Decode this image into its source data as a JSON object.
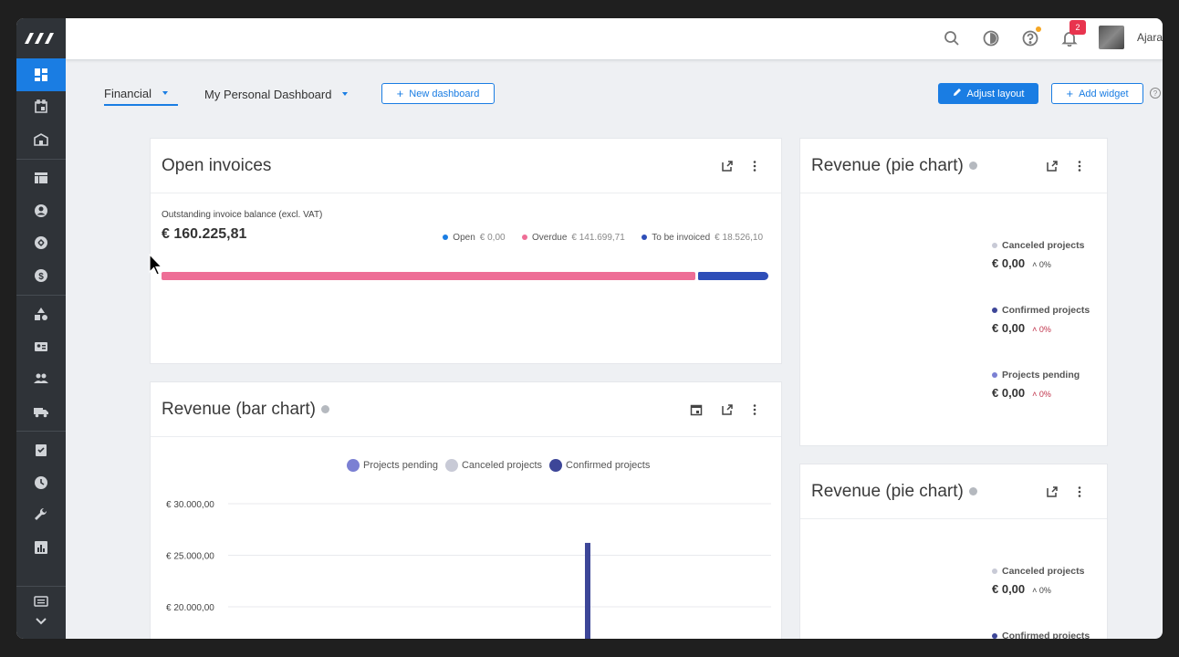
{
  "topbar": {
    "username": "Ajara",
    "notifications_count": "2"
  },
  "sidebar": {
    "items": [
      "dashboard",
      "calendar",
      "organization",
      "table",
      "contact",
      "sync",
      "dollar",
      "shapes",
      "id-card",
      "people",
      "truck",
      "task",
      "clock",
      "wrench",
      "report",
      "feedback"
    ]
  },
  "tabs": [
    {
      "label": "Financial"
    },
    {
      "label": "My Personal Dashboard"
    }
  ],
  "buttons": {
    "new_dashboard": "New dashboard",
    "adjust_layout": "Adjust layout",
    "add_widget": "Add widget"
  },
  "open_invoices": {
    "title": "Open invoices",
    "subtitle": "Outstanding invoice balance (excl. VAT)",
    "total": "€ 160.225,81",
    "legend": [
      {
        "label": "Open",
        "value": "€ 0,00",
        "color": "#1a7de3"
      },
      {
        "label": "Overdue",
        "value": "€ 141.699,71",
        "color": "#ee6e96"
      },
      {
        "label": "To be invoiced",
        "value": "€ 18.526,10",
        "color": "#2e4eb8"
      }
    ],
    "overdue_fraction": 0.884,
    "to_invoice_fraction": 0.116
  },
  "pie1": {
    "title": "Revenue (pie chart)",
    "entries": [
      {
        "label": "Canceled projects",
        "value": "€ 0,00",
        "pct": "0%",
        "color": "#c8cad6",
        "pct_color": "#444"
      },
      {
        "label": "Confirmed projects",
        "value": "€ 0,00",
        "pct": "0%",
        "color": "#3d4698",
        "pct_color": "#c0324a"
      },
      {
        "label": "Projects pending",
        "value": "€ 0,00",
        "pct": "0%",
        "color": "#7b80d3",
        "pct_color": "#c0324a"
      }
    ]
  },
  "pie2": {
    "title": "Revenue (pie chart)",
    "entries": [
      {
        "label": "Canceled projects",
        "value": "€ 0,00",
        "pct": "0%",
        "color": "#c8cad6",
        "pct_color": "#444"
      },
      {
        "label": "Confirmed projects",
        "color": "#3d4698"
      }
    ]
  },
  "bar_chart": {
    "title": "Revenue (bar chart)"
  },
  "chart_data": {
    "type": "bar",
    "title": "",
    "series": [
      {
        "name": "Projects pending",
        "color": "#7b80d3"
      },
      {
        "name": "Canceled projects",
        "color": "#c8cad6"
      },
      {
        "name": "Confirmed projects",
        "color": "#3d4698"
      }
    ],
    "yticks": [
      "€ 30.000,00",
      "€ 25.000,00",
      "€ 20.000,00"
    ],
    "ytick_values": [
      30000,
      25000,
      20000
    ],
    "visible_bar_value": 26200
  }
}
